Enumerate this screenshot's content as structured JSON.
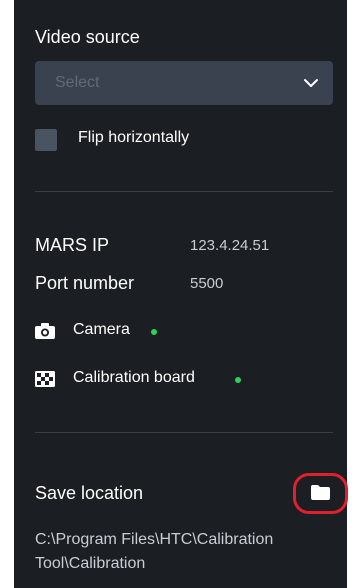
{
  "video_source": {
    "title": "Video source",
    "select_placeholder": "Select",
    "flip_label": "Flip horizontally",
    "flip_checked": false
  },
  "connection": {
    "ip_label": "MARS IP",
    "ip_value": "123.4.24.51",
    "port_label": "Port number",
    "port_value": "5500"
  },
  "status": {
    "camera_label": "Camera",
    "camera_icon": "camera-icon",
    "camera_status_color": "#2bd25a",
    "board_label": "Calibration board",
    "board_icon": "checkerboard-icon",
    "board_status_color": "#2bd25a"
  },
  "save": {
    "title": "Save location",
    "path": "C:\\Program Files\\HTC\\Calibration Tool\\Calibration",
    "button_icon": "folder-icon",
    "highlight_color": "#e0202c"
  },
  "theme": {
    "panel_bg": "#1b1e22",
    "field_bg": "#3a4250"
  }
}
